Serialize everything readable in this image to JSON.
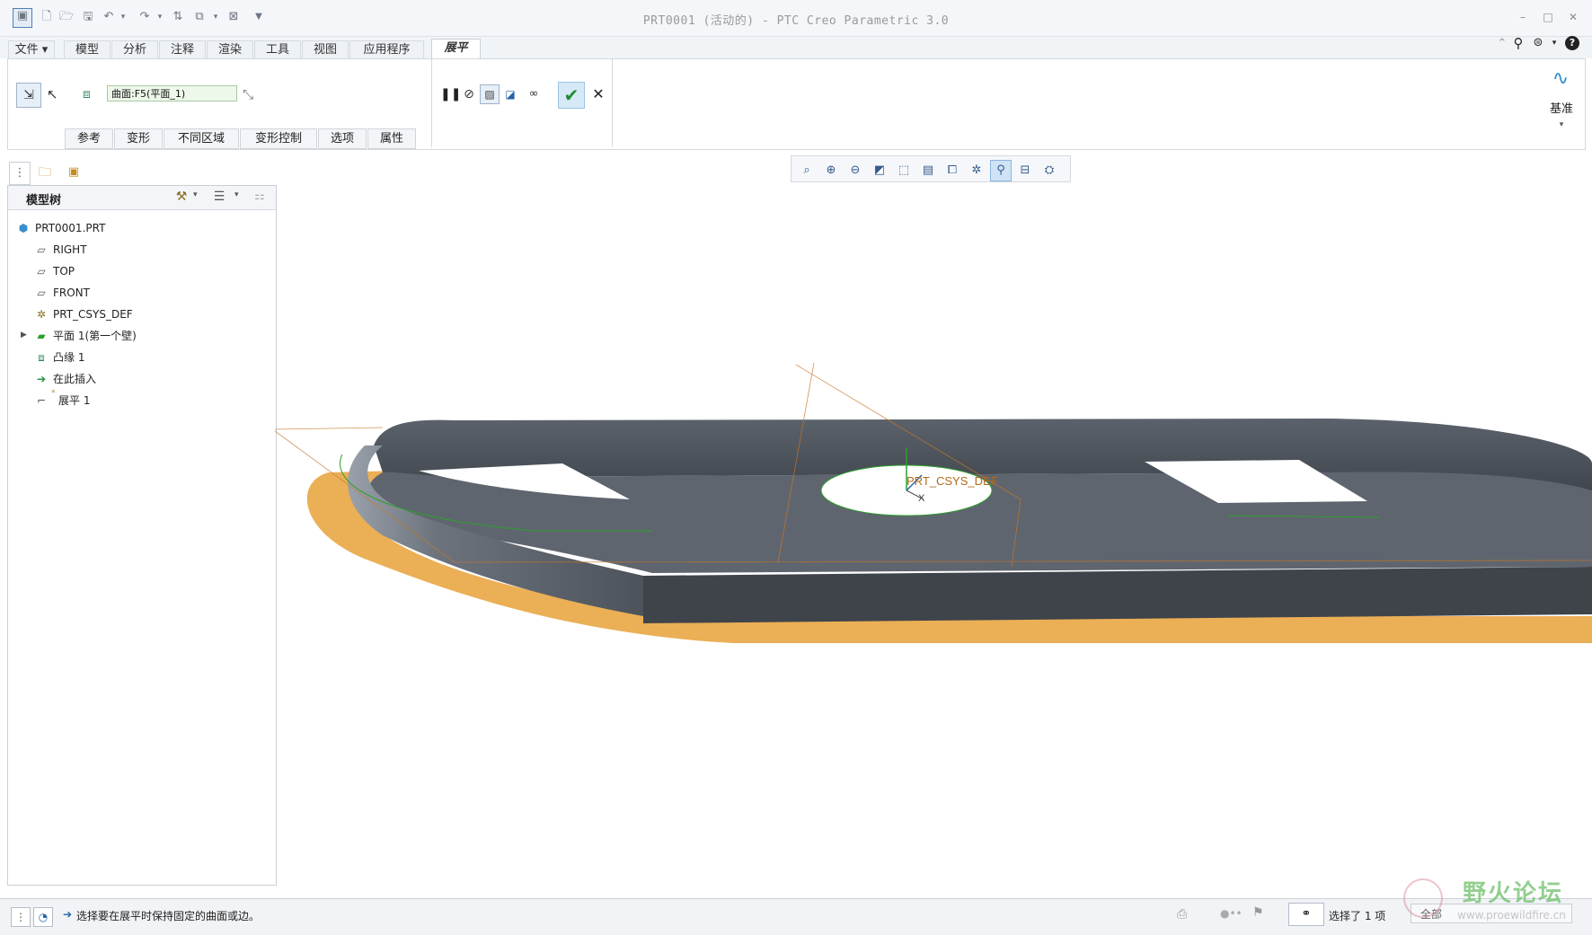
{
  "window": {
    "title": "PRT0001 (活动的) - PTC Creo Parametric 3.0"
  },
  "ribbon": {
    "tabs": [
      "文件",
      "模型",
      "分析",
      "注释",
      "渲染",
      "工具",
      "视图",
      "应用程序",
      "展平"
    ],
    "active_tab": "展平",
    "surface_field_value": "曲面:F5(平面_1)",
    "subtabs": [
      "参考",
      "变形",
      "不同区域",
      "变形控制",
      "选项",
      "属性"
    ],
    "datum_label": "基准"
  },
  "model_tree": {
    "title": "模型树",
    "items": [
      {
        "label": "PRT0001.PRT",
        "icon": "part-icon"
      },
      {
        "label": "RIGHT",
        "icon": "datum-plane-icon"
      },
      {
        "label": "TOP",
        "icon": "datum-plane-icon"
      },
      {
        "label": "FRONT",
        "icon": "datum-plane-icon"
      },
      {
        "label": "PRT_CSYS_DEF",
        "icon": "csys-icon"
      },
      {
        "label": "平面 1(第一个壁)",
        "icon": "wall-icon"
      },
      {
        "label": "凸缘 1",
        "icon": "flange-icon"
      },
      {
        "label": "在此插入",
        "icon": "insert-arrow-icon"
      },
      {
        "label": "展平 1",
        "icon": "flatten-icon"
      }
    ]
  },
  "viewport": {
    "csys_label": "PRT_CSYS_DEF",
    "axis_label": "X"
  },
  "statusbar": {
    "message": "选择要在展平时保持固定的曲面或边。",
    "selection_count": "选择了 1 项",
    "filter_value": "全部"
  },
  "watermark": {
    "text": "野火论坛",
    "url": "www.proewildfire.cn"
  },
  "colors": {
    "accent_green": "#2ca02c",
    "highlight_orange": "#e8a23a",
    "model_dark": "#4c525b",
    "ribbon_active_bg": "#ffffff"
  }
}
